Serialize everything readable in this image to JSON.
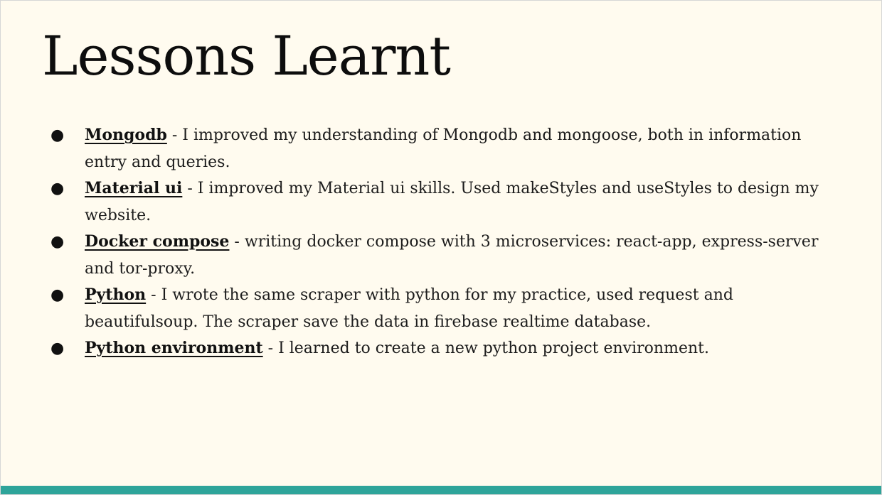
{
  "slide": {
    "title": "Lessons Learnt",
    "bullet_glyph": "●",
    "separator": " - ",
    "items": [
      {
        "term": "Mongodb",
        "text": "I improved my understanding of Mongodb and mongoose, both in information entry and queries."
      },
      {
        "term": "Material ui",
        "text": "I improved my Material ui skills. Used makeStyles  and useStyles to design my website."
      },
      {
        "term": "Docker compose",
        "text": "writing docker compose with 3 microservices: react-app, express-server and tor-proxy."
      },
      {
        "term": "Python",
        "text": "I wrote the same scraper with python for my practice, used request and beautifulsoup. The scraper save the data in firebase realtime database."
      },
      {
        "term": "Python environment",
        "text": "I learned to create a new python project environment."
      }
    ]
  },
  "colors": {
    "background": "#fffbef",
    "accent_bar": "#2ea49a",
    "text": "#1c1c1c"
  }
}
